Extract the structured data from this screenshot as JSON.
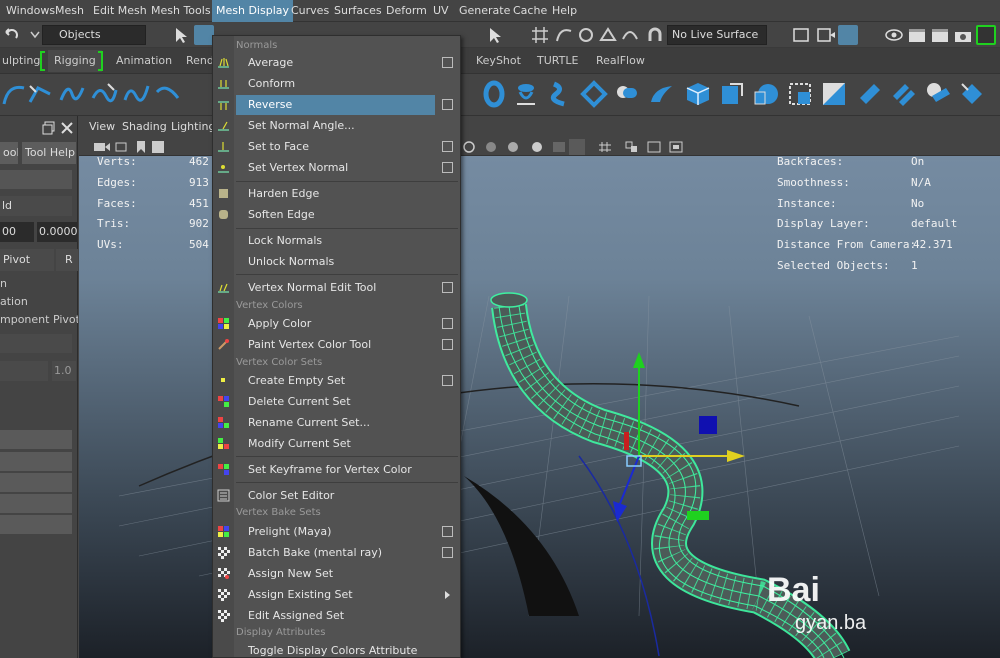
{
  "menubar": {
    "items": [
      "Windows",
      "Mesh",
      "Edit Mesh",
      "Mesh Tools",
      "Mesh Display",
      "Curves",
      "Surfaces",
      "Deform",
      "UV",
      "Generate",
      "Cache",
      "Help"
    ],
    "active": "Mesh Display"
  },
  "statusline": {
    "objects_field": "Objects",
    "live_surface": "No Live Surface"
  },
  "shelf_tabs": [
    "ulpting",
    "Rigging",
    "Animation",
    "Rend",
    "KeyShot",
    "TURTLE",
    "RealFlow"
  ],
  "left_panel": {
    "tool_label": "ool",
    "tool_help": "Tool Help",
    "field_ld": "ld",
    "value_a": "00",
    "value_b": "0.0000",
    "pivot_label": "Pivot",
    "r_label": "R",
    "text_n": "n",
    "text_ation": "ation",
    "text_component_pivot": "mponent Pivot",
    "value_one": "1.0"
  },
  "viewport": {
    "menu": [
      "View",
      "Shading",
      "Lighting"
    ],
    "hud_left": [
      {
        "label": "Verts:",
        "value": "462"
      },
      {
        "label": "Edges:",
        "value": "913"
      },
      {
        "label": "Faces:",
        "value": "451"
      },
      {
        "label": "Tris:",
        "value": "902"
      },
      {
        "label": "UVs:",
        "value": "504"
      }
    ],
    "hud_right": [
      {
        "label": "Backfaces:",
        "value": "On"
      },
      {
        "label": "Smoothness:",
        "value": "N/A"
      },
      {
        "label": "Instance:",
        "value": "No"
      },
      {
        "label": "Display Layer:",
        "value": "default"
      },
      {
        "label": "Distance From Camera:",
        "value": "42.371"
      },
      {
        "label": "Selected Objects:",
        "value": "1"
      }
    ],
    "watermark_1": "Bai",
    "watermark_2": "gyan.ba"
  },
  "dropdown": {
    "sections": {
      "normals": "Normals",
      "vertex_colors": "Vertex Colors",
      "vertex_color_sets": "Vertex Color Sets",
      "vertex_bake_sets": "Vertex Bake Sets",
      "display_attributes": "Display Attributes"
    },
    "items": {
      "average": "Average",
      "conform": "Conform",
      "reverse": "Reverse",
      "set_normal_angle": "Set Normal Angle...",
      "set_to_face": "Set to Face",
      "set_vertex_normal": "Set Vertex Normal",
      "harden_edge": "Harden Edge",
      "soften_edge": "Soften Edge",
      "lock_normals": "Lock Normals",
      "unlock_normals": "Unlock Normals",
      "vertex_normal_edit_tool": "Vertex Normal Edit Tool",
      "apply_color": "Apply Color",
      "paint_vertex_color_tool": "Paint Vertex Color Tool",
      "create_empty_set": "Create Empty Set",
      "delete_current_set": "Delete Current Set",
      "rename_current_set": "Rename Current Set...",
      "modify_current_set": "Modify Current Set",
      "set_keyframe_for_vertex_color": "Set Keyframe for Vertex Color",
      "color_set_editor": "Color Set Editor",
      "prelight_maya": "Prelight (Maya)",
      "batch_bake_mental_ray": "Batch Bake (mental ray)",
      "assign_new_set": "Assign New Set",
      "assign_existing_set": "Assign Existing Set",
      "edit_assigned_set": "Edit Assigned Set",
      "toggle_display_colors_attribute": "Toggle Display Colors Attribute"
    }
  },
  "colors": {
    "highlight": "#5285a6",
    "wireframe": "#3ef0a0",
    "shelf_blue": "#2f8fd6"
  }
}
